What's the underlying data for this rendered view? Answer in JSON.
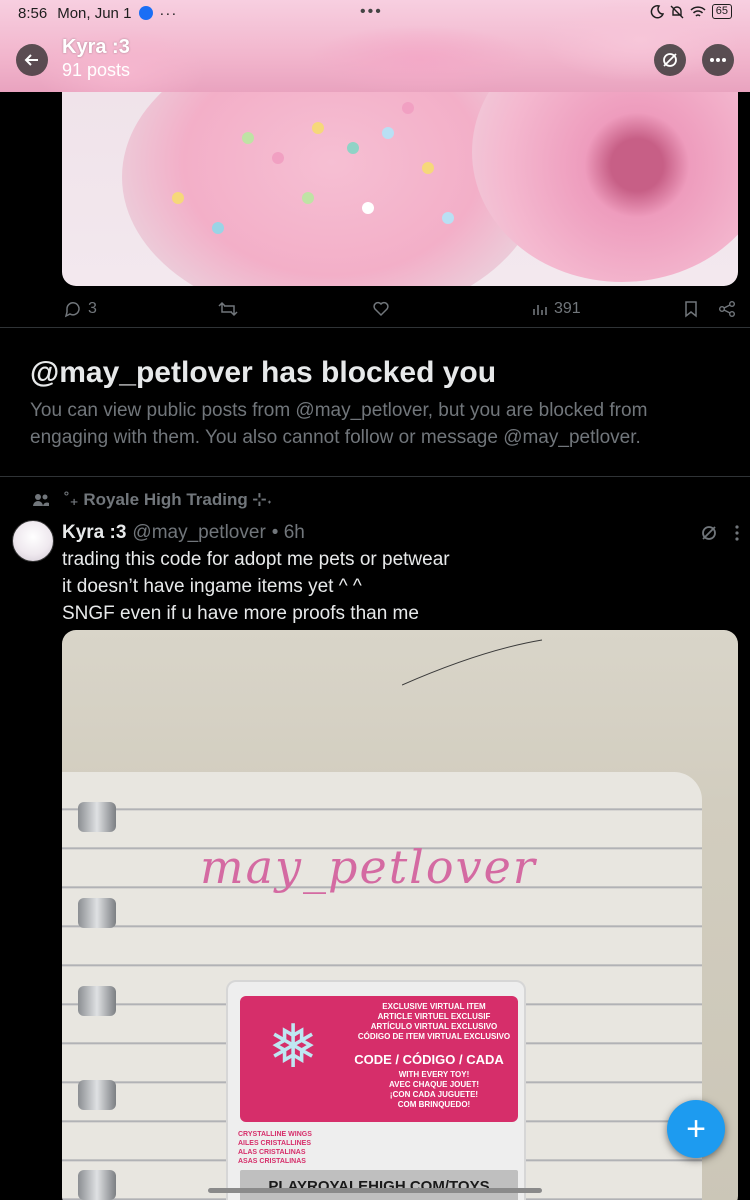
{
  "status_bar": {
    "time": "8:56",
    "date": "Mon, Jun 1",
    "overflow": "···",
    "center_dots": "•••",
    "battery": "65"
  },
  "header": {
    "name": "Kyra :3",
    "posts": "91 posts"
  },
  "prev_post_actions": {
    "replies": "3",
    "views": "391"
  },
  "blocked": {
    "title": "@may_petlover has blocked you",
    "text": "You can view public posts from @may_petlover, but you are blocked from engaging with them. You also cannot follow or message @may_petlover."
  },
  "community": {
    "name": "˚₊ Royale High Trading ⊹˖"
  },
  "tweet": {
    "name": "Kyra :3",
    "handle": "@may_petlover",
    "time": "• 6h",
    "lines": [
      "trading this code for adopt me pets or petwear",
      "it doesn’t have ingame items yet ^ ^",
      "SNGF even if u have more proofs than me"
    ]
  },
  "photo": {
    "handwriting": "may_petlover",
    "card_header_lines": [
      "EXCLUSIVE VIRTUAL ITEM",
      "ARTICLE VIRTUEL EXCLUSIF",
      "ARTÍCULO VIRTUAL EXCLUSIVO",
      "CÓDIGO DE ITEM VIRTUAL EXCLUSIVO"
    ],
    "card_code": "CODE / CÓDIGO / CADA",
    "card_toy_lines": [
      "WITH EVERY TOY!",
      "AVEC CHAQUE JOUET!",
      "¡CON CADA JUGUETE!",
      "COM BRINQUEDO!"
    ],
    "card_wing_names": [
      "CRYSTALLINE WINGS",
      "AILES CRISTALLINES",
      "ALAS CRISTALINAS",
      "ASAS CRISTALINAS"
    ],
    "card_url": "PLAYROYALEHIGH.COM/TOYS"
  },
  "fab": {
    "label": "+"
  },
  "colors": {
    "accent": "#1d9bf0",
    "muted": "#71767b",
    "card_pink": "#d62e6a"
  }
}
